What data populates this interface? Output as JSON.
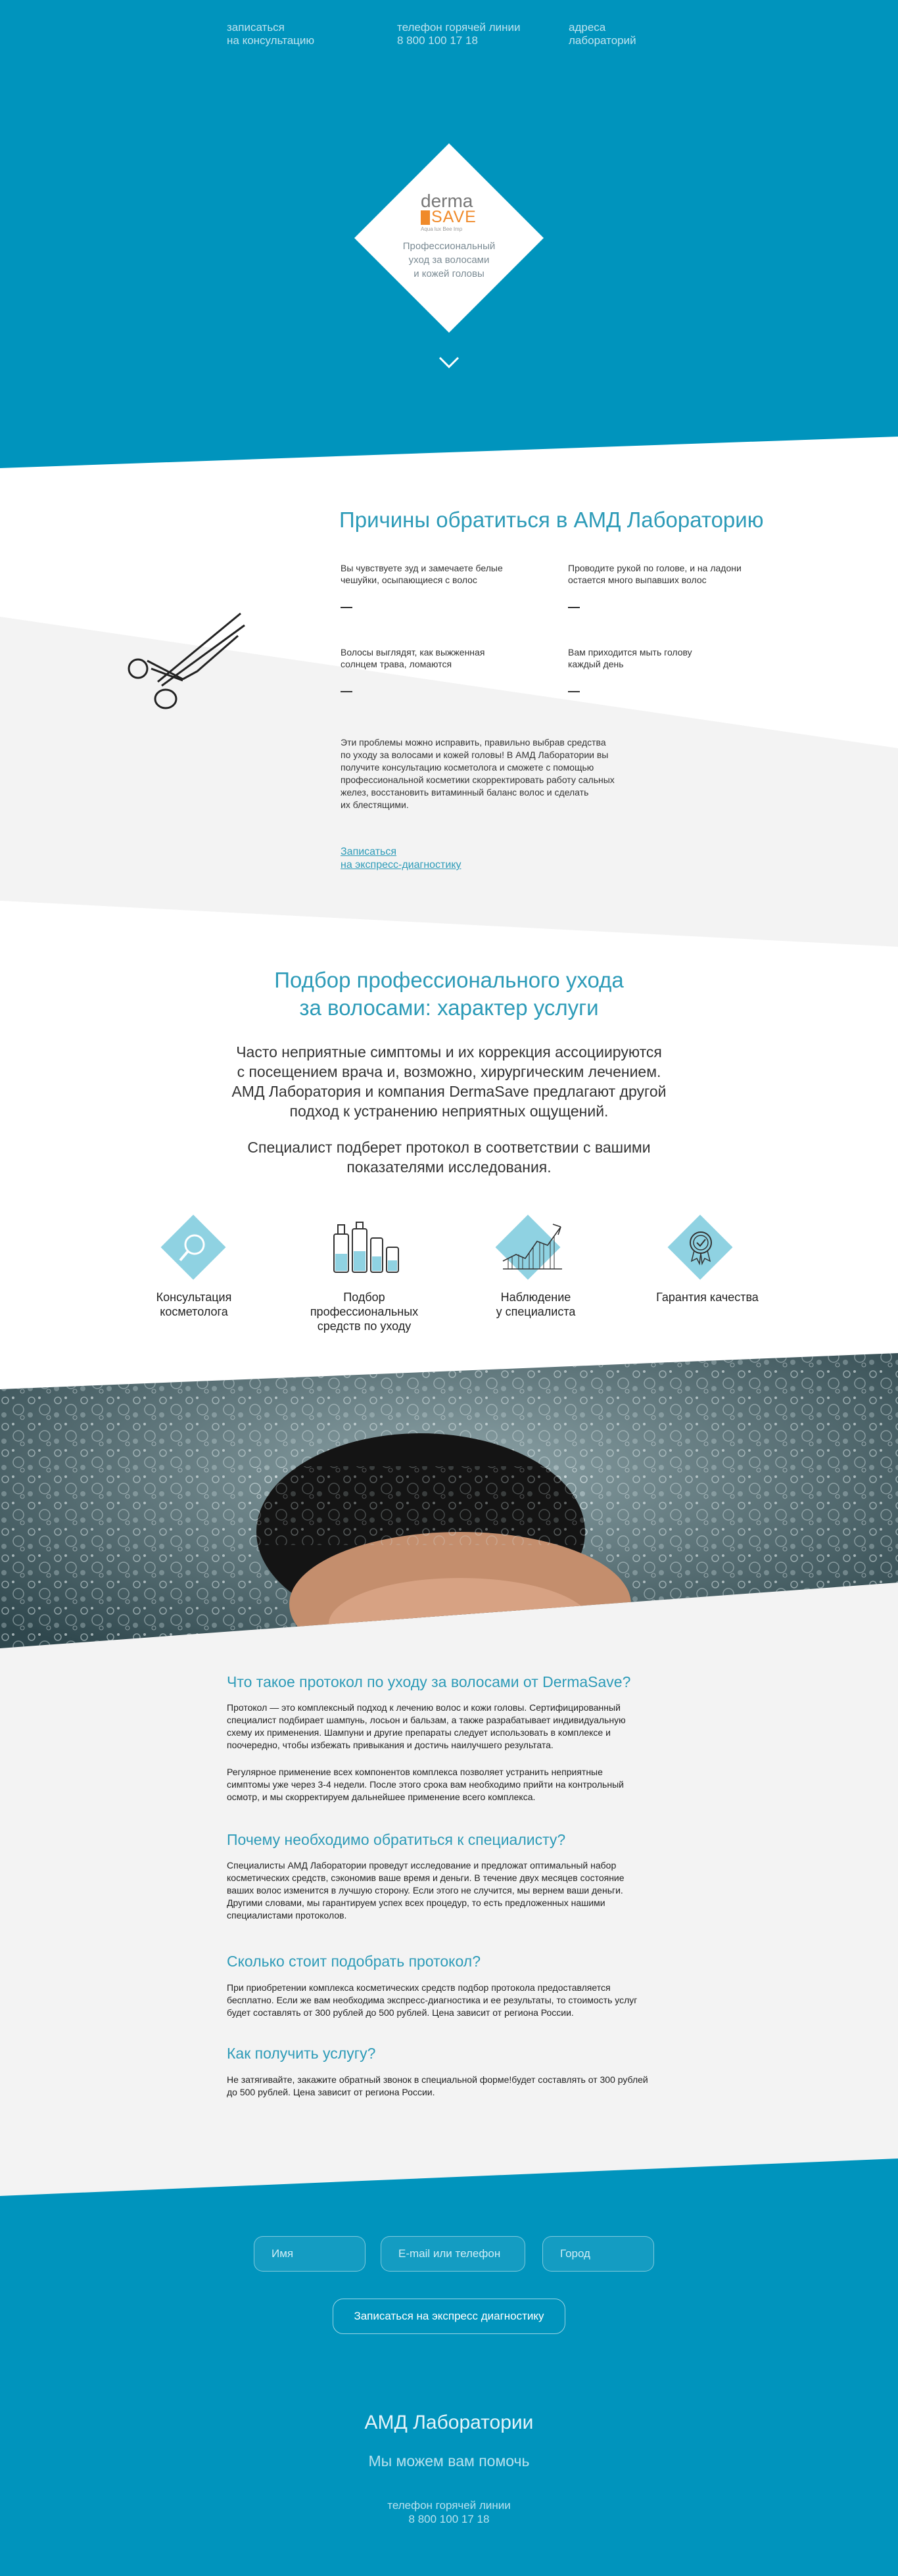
{
  "nav": {
    "consult_line1": "записаться",
    "consult_line2": "на консультацию",
    "hotline_label": "телефон горячей линии",
    "hotline_number": "8 800 100 17 18",
    "addresses_line1": "адреса",
    "addresses_line2": "лабораторий"
  },
  "logo": {
    "derma": "derma",
    "save": "SAVE",
    "tagline": "Aqua lux Bee Imp",
    "caption_line1": "Профессиональный",
    "caption_line2": "уход за волосами",
    "caption_line3": "и кожей головы"
  },
  "reasons": {
    "title": "Причины обратиться в АМД Лабораторию",
    "items": [
      {
        "line1": "Вы чувствуете зуд и замечаете белые",
        "line2": "чешуйки, осыпающиеся с волос"
      },
      {
        "line1": "Проводите рукой по голове, и на ладони",
        "line2": "остается много выпавших волос"
      },
      {
        "line1": "Волосы выглядят, как выжженная",
        "line2": "солнцем трава, ломаются"
      },
      {
        "line1": "Вам приходится мыть голову",
        "line2": "каждый день"
      }
    ],
    "body": [
      "Эти проблемы можно исправить, правильно выбрав средства",
      "по уходу за волосами и кожей головы! В АМД Лаборатории вы",
      "получите консультацию косметолога и сможете с помощью",
      "профессиональной косметики скорректировать работу сальных",
      "желез, восстановить витаминный баланс волос и сделать",
      "их блестящими."
    ],
    "link_line1": "Записаться",
    "link_line2": "на экспресс-диагностику"
  },
  "service": {
    "title_line1": "Подбор профессионального ухода",
    "title_line2": "за волосами: характер услуги",
    "para1": [
      "Часто неприятные симптомы и их коррекция ассоциируются",
      "с посещением врача и, возможно, хирургическим лечением.",
      "АМД Лаборатория и компания DermaSave предлагают другой",
      "подход к устранению неприятных ощущений."
    ],
    "para2": [
      "Специалист подберет протокол в соответствии с вашими",
      "показателями исследования."
    ],
    "features": [
      {
        "icon": "magnifier-icon",
        "line1": "Консультация",
        "line2": "косметолога",
        "line3": ""
      },
      {
        "icon": "bottles-icon",
        "line1": "Подбор",
        "line2": "профессиональных",
        "line3": "средств по уходу"
      },
      {
        "icon": "chart-icon",
        "line1": "Наблюдение",
        "line2": "у специалиста",
        "line3": ""
      },
      {
        "icon": "quality-badge-icon",
        "line1": "Гарантия качества",
        "line2": "",
        "line3": ""
      }
    ]
  },
  "info": {
    "h1": "Что такое протокол по уходу за волосами от DermaSave?",
    "p1": [
      "Протокол — это комплексный подход к лечению волос и кожи головы. Сертифицированный",
      "специалист подбирает шампунь, лосьон и бальзам, а также разрабатывает индивидуальную",
      "схему их применения. Шампуни и другие препараты следует использовать в комплексе и",
      "поочередно, чтобы избежать привыкания и достичь наилучшего результата."
    ],
    "p2": [
      "Регулярное применение всех компонентов комплекса позволяет устранить неприятные",
      "симптомы уже через 3-4 недели. После этого срока вам необходимо прийти на контрольный",
      "осмотр, и мы скорректируем дальнейшее применение всего комплекса."
    ],
    "h2": "Почему необходимо обратиться к специалисту?",
    "p3": [
      "Специалисты АМД Лаборатории  проведут исследование и предложат оптимальный набор",
      "косметических средств, сэкономив ваше время и деньги.  В течение двух месяцев состояние",
      "ваших волос изменится в лучшую сторону. Если этого не случится, мы вернем ваши деньги.",
      "Другими словами, мы гарантируем успех всех процедур, то есть предложенных нашими",
      "специалистами протоколов."
    ],
    "h3": "Сколько стоит подобрать протокол?",
    "p4": [
      "При приобретении комплекса косметических средств подбор протокола предоставляется",
      "бесплатно. Если же вам необходима экспресс-диагностика и ее результаты, то стоимость услуг",
      "будет составлять от 300 рублей до 500 рублей. Цена зависит от региона России."
    ],
    "h4": "Как получить услугу?",
    "p5": [
      "Не затягивайте, закажите обратный звонок в специальной форме!будет составлять от 300 рублей",
      "до 500 рублей. Цена зависит от региона России."
    ]
  },
  "form": {
    "name_placeholder": "Имя",
    "contact_placeholder": "E-mail или телефон",
    "city_placeholder": "Город",
    "submit_label": "Записаться на экспресс диагностику"
  },
  "footer": {
    "title": "АМД Лаборатории",
    "subtitle": "Мы можем вам помочь",
    "hotline_label": "телефон горячей линии",
    "hotline_number": "8 800 100 17 18"
  },
  "colors": {
    "brand_blue": "#0094bd",
    "accent_teal": "#2d9bb8",
    "icon_diamond": "#8fd2e2",
    "logo_orange": "#f08a2a"
  }
}
